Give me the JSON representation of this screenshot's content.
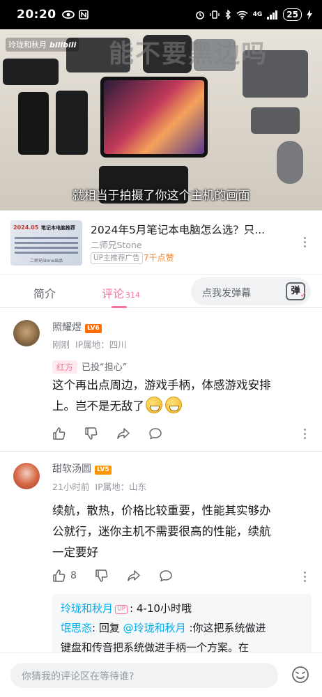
{
  "status_bar": {
    "time": "20:20",
    "network": "4G",
    "battery": "25"
  },
  "video": {
    "uploader_tag": "玲珑和秋月",
    "platform_logo": "bilibili",
    "watermark": "能不要黑边吗",
    "subtitle": "就相当于拍摄了你这个主机的画面"
  },
  "promo": {
    "thumb_badge": "2024.05",
    "thumb_title": "笔记本电脑推荐",
    "thumb_footer": "二师兄Stone出品",
    "title": "2024年5月笔记本电脑怎么选？只...",
    "author": "二师兄Stone",
    "ad_label": "UP主推荐广告",
    "likes": "7千点赞"
  },
  "tabs": {
    "intro": "简介",
    "comments": "评论",
    "comments_count": "314",
    "danmaku_placeholder": "点我发弹幕",
    "danmaku_icon_label": "弹"
  },
  "comments": [
    {
      "user": "照耀煜",
      "level": "LV6",
      "level_color": "#ff6c00",
      "time": "刚刚",
      "ip": "IP属地：四川",
      "vote_side": "红方",
      "vote_text": "已投“担心”",
      "text_line1": "这个再出点周边，游戏手柄，体感游戏安排",
      "text_line2": "上。岂不是无敌了",
      "likes": ""
    },
    {
      "user": "甜软汤圆",
      "level": "LV5",
      "level_color": "#ff9500",
      "time": "21小时前",
      "ip": "IP属地：山东",
      "text_line1": "续航，散热，价格比较重要，性能其实够办",
      "text_line2": "公就行，迷你主机不需要很高的性能，续航",
      "text_line3": "一定要好",
      "likes": "8"
    }
  ],
  "replies": [
    {
      "user": "玲珑和秋月",
      "badge": "UP",
      "text": "4-10小时哦"
    },
    {
      "user": "氓思忞",
      "reply_prefix": "回复",
      "mention": "@玲珑和秋月",
      "text": ":你这把系统做进",
      "text2": "键盘和传音把系统做进手柄一个方案。在"
    }
  ],
  "bottom_bar": {
    "placeholder": "你猜我的评论区在等待谁?"
  }
}
